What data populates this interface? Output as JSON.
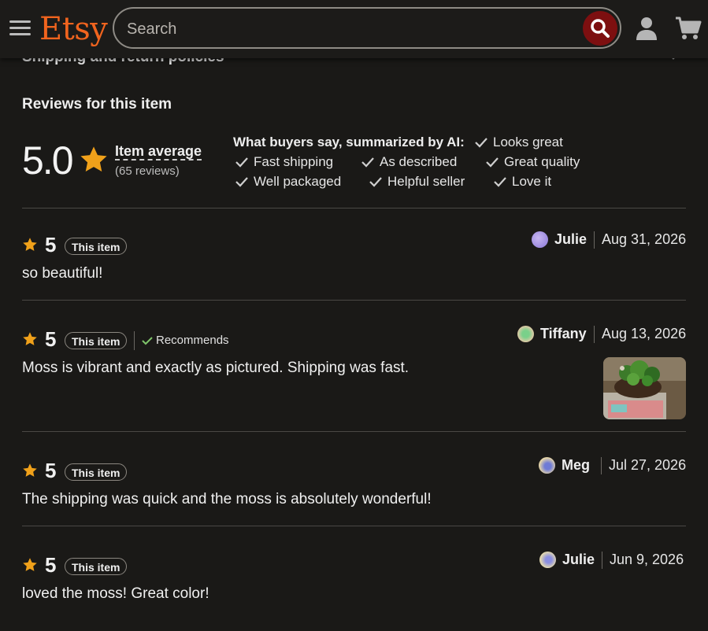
{
  "header": {
    "logo": "Etsy",
    "search_placeholder": "Search"
  },
  "policies": {
    "title": "Shipping and return policies"
  },
  "reviews": {
    "title": "Reviews for this item",
    "average": "5.0",
    "average_label": "Item average",
    "count_label": "(65 reviews)",
    "ai_title": "What buyers say, summarized by AI:",
    "tags": [
      "Looks great",
      "Fast shipping",
      "As described",
      "Great quality",
      "Well packaged",
      "Helpful seller",
      "Love it"
    ],
    "items": [
      {
        "rating": "5",
        "badge": "This item",
        "author": "Julie",
        "date": "Aug 31, 2026",
        "text": "so beautiful!",
        "recommends": ""
      },
      {
        "rating": "5",
        "badge": "This item",
        "author": "Tiffany",
        "date": "Aug 13, 2026",
        "text": "Moss is vibrant and exactly as pictured. Shipping was fast.",
        "recommends": "Recommends"
      },
      {
        "rating": "5",
        "badge": "This item",
        "author": "Meg",
        "date": "Jul 27, 2026",
        "text": "The shipping was quick and the moss is absolutely wonderful!",
        "recommends": ""
      },
      {
        "rating": "5",
        "badge": "This item",
        "author": "Julie",
        "date": "Jun 9, 2026",
        "text": "loved the moss! Great color!",
        "recommends": ""
      }
    ]
  },
  "colors": {
    "brand": "#f1641e",
    "star": "#f0a11a",
    "search_button": "#7d0f10",
    "background": "#1a1917"
  },
  "icons": [
    "menu-icon",
    "search-icon",
    "user-icon",
    "cart-icon",
    "chevron-down-icon",
    "star-icon",
    "check-icon"
  ]
}
